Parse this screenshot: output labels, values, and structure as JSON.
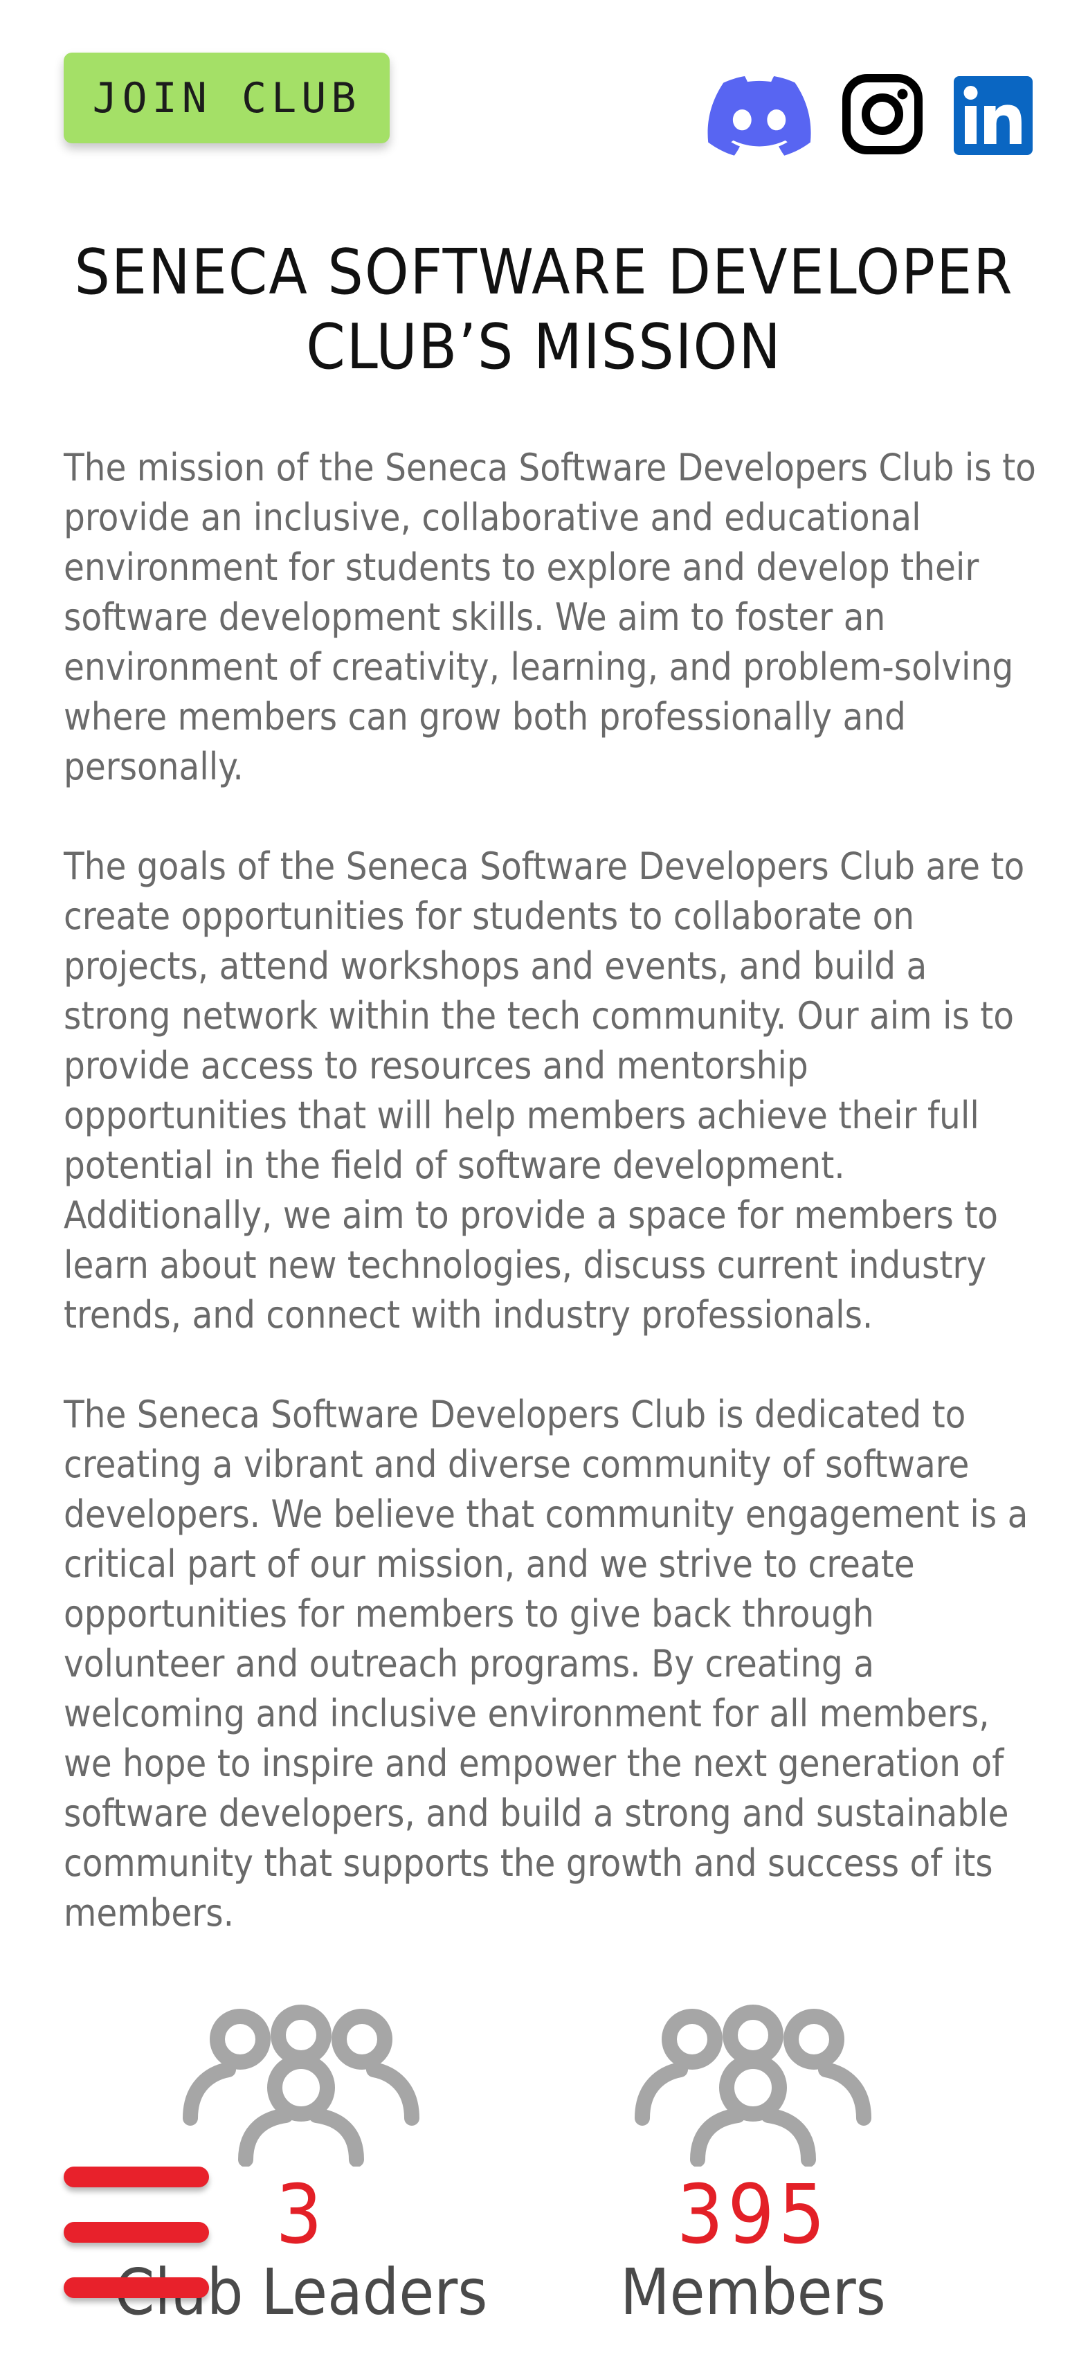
{
  "header": {
    "join_label": "JOIN CLUB",
    "social": [
      {
        "name": "Discord",
        "icon": "discord-icon",
        "color": "#5865f2"
      },
      {
        "name": "Instagram",
        "icon": "instagram-icon",
        "color": "#000000"
      },
      {
        "name": "LinkedIn",
        "icon": "linkedin-icon",
        "color": "#0a66c2"
      }
    ]
  },
  "mission": {
    "title_line1": "SENECA SOFTWARE DEVELOPER",
    "title_line2": "CLUB’S MISSION",
    "paragraphs": [
      "The mission of the Seneca Software Developers Club is to provide an inclusive, collaborative and educational environment for students to explore and develop their software development skills. We aim to foster an environment of creativity, learning, and problem-solving where members can grow both professionally and personally.",
      "The goals of the Seneca Software Developers Club are to create opportunities for students to collaborate on projects, attend workshops and events, and build a strong network within the tech community. Our aim is to provide access to resources and mentorship opportunities that will help members achieve their full potential in the field of software development. Additionally, we aim to provide a space for members to learn about new technologies, discuss current industry trends, and connect with industry professionals.",
      "The Seneca Software Developers Club is dedicated to creating a vibrant and diverse community of software developers. We believe that community engagement is a critical part of our mission, and we strive to create opportunities for members to give back through volunteer and outreach programs. By creating a welcoming and inclusive environment for all members, we hope to inspire and empower the next generation of software developers, and build a strong and sustainable community that supports the growth and success of its members."
    ]
  },
  "stats": [
    {
      "value": "3",
      "label": "Club Leaders",
      "icon": "group-icon"
    },
    {
      "value": "395",
      "label": "Members",
      "icon": "group-icon"
    }
  ],
  "menu": {
    "icon": "hamburger-menu-icon"
  },
  "colors": {
    "join_button": "#a4e067",
    "stat_value": "#e32027",
    "menu_bars": "#e8212b",
    "paragraph_text": "#6a6a6a",
    "icon_gray": "#a6a6a6"
  }
}
